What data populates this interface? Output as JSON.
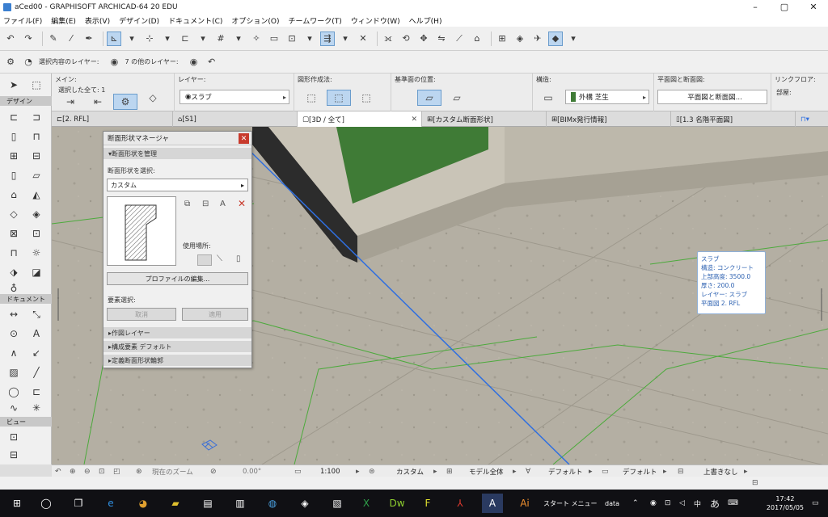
{
  "window": {
    "title": "aCed00 - GRAPHISOFT ARCHICAD-64 20 EDU",
    "minimize": "–",
    "maximize": "▢",
    "close": "✕"
  },
  "menu": [
    "ファイル(F)",
    "編集(E)",
    "表示(V)",
    "デザイン(D)",
    "ドキュメント(C)",
    "オプション(O)",
    "チームワーク(T)",
    "ウィンドウ(W)",
    "ヘルプ(H)"
  ],
  "toolbar2": {
    "label_selection": "選択内容のレイヤー:",
    "label_other": "7 の他のレイヤー:"
  },
  "infobox": {
    "main_label": "メイン:",
    "selected_all": "選択した全て: 1",
    "layer_label": "レイヤー:",
    "layer_value": "スラブ",
    "geometry_label": "図形作成法:",
    "ref_label": "基準面の位置:",
    "structure_label": "構造:",
    "structure_value": "外構 芝生",
    "floor_label": "平面図と断面図:",
    "floor_value": "平面図と断面図...",
    "link_label": "リンクフロア:",
    "link_value": "部屋:"
  },
  "toolbox": {
    "design": "デザイン",
    "document": "ドキュメント",
    "view": "ビュー"
  },
  "tabs": [
    {
      "label": "[2. RFL]"
    },
    {
      "label": "[S1]"
    },
    {
      "label": "[3D / 全て]"
    },
    {
      "label": "[カスタム断面形状]"
    },
    {
      "label": "[BIMx発行情報]"
    },
    {
      "label": "[1.3 名階平面図]"
    }
  ],
  "palette": {
    "title": "断面形状マネージャ",
    "section_manage": "断面形状を管理",
    "select_label": "断面形状を選択:",
    "select_value": "カスタム",
    "usage_label": "使用場所:",
    "edit_profile": "プロファイルの編集...",
    "element_select": "要素選択:",
    "cancel": "取消",
    "apply": "適用",
    "section_layer": "作図レイヤー",
    "section_default": "構成要素 デフォルト",
    "section_outline": "定義断面形状輪郭"
  },
  "tooltip": {
    "lines": [
      "スラブ",
      "構造: コンクリート",
      "上部高度: 3500.0",
      "厚さ: 200.0",
      "レイヤー: スラブ",
      "平面図 2. RFL"
    ]
  },
  "statusbar": {
    "zoom": "現在のズーム",
    "angle": "0.00°",
    "scale": "1:100",
    "pen": "カスタム",
    "model": "モデル全体",
    "default1": "デフォルト",
    "default2": "デフォルト",
    "override": "上書きなし"
  },
  "taskbar": {
    "start_menu": "スタート メニュー",
    "data": "data",
    "ime": "あ",
    "time": "17:42",
    "date": "2017/05/05"
  },
  "colors": {
    "accent": "#3a7fd0",
    "grass": "#3f7b36",
    "blue_line": "#2f6fe0",
    "green_line": "#4caa3c",
    "close_red": "#c83a2c",
    "tooltip_text": "#2a5fb0"
  }
}
